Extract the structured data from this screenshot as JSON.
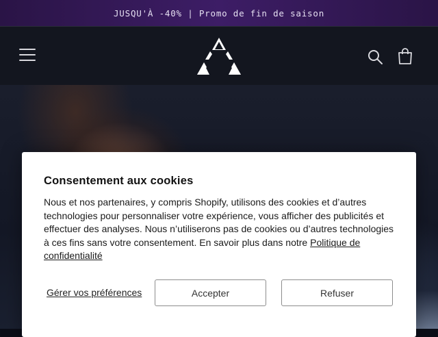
{
  "announcement": {
    "text": "JUSQU'À -40% | Promo de fin de saison"
  },
  "header": {
    "menu_icon": "hamburger-menu-icon",
    "logo_icon": "triangle-logo-icon",
    "search_icon": "search-icon",
    "cart_icon": "shopping-bag-icon"
  },
  "cookie_banner": {
    "title": "Consentement aux cookies",
    "body": "Nous et nos partenaires, y compris Shopify, utilisons des cookies et d’autres technologies pour personnaliser votre expérience, vous afficher des publicités et effectuer des analyses. Nous n’utiliserons pas de cookies ou d’autres technologies à ces fins sans votre consentement. En savoir plus dans notre ",
    "privacy_link": "Politique de confidentialité",
    "manage_preferences": "Gérer vos préférences",
    "accept": "Accepter",
    "refuse": "Refuser"
  },
  "colors": {
    "announcement_bg": "#3d1d66",
    "header_bg": "#13161f",
    "modal_bg": "#ffffff"
  }
}
